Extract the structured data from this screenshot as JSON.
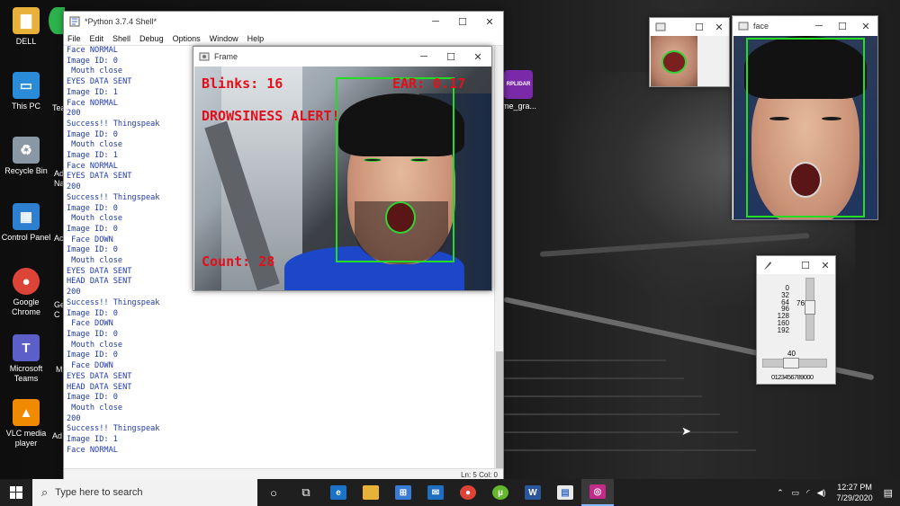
{
  "desktop": {
    "icons": [
      {
        "label": "DELL",
        "icon": "folder-user-icon",
        "color": "#e8b23a"
      },
      {
        "label": "This PC",
        "icon": "monitor-icon",
        "color": "#2a8cd8"
      },
      {
        "label": "Recycle Bin",
        "icon": "recycle-bin-icon",
        "color": "#8a98a6"
      },
      {
        "label": "Control Panel",
        "icon": "control-panel-icon",
        "color": "#2d7fd0"
      },
      {
        "label": "Google Chrome",
        "icon": "chrome-icon",
        "color": "#db4437"
      },
      {
        "label": "Microsoft Teams",
        "icon": "teams-icon",
        "color": "#5b5fc7"
      },
      {
        "label": "VLC media player",
        "icon": "vlc-icon",
        "color": "#f08a00"
      }
    ],
    "partial_labels": [
      "Tea",
      "Ad Na",
      "Ac",
      "Ge C",
      "M",
      "Ad"
    ],
    "file_icon": {
      "label": "ime_gra...",
      "glyph": "RPLIDAR",
      "color": "#7a2aa8"
    }
  },
  "shell": {
    "title": "*Python 3.7.4 Shell*",
    "menu": [
      "File",
      "Edit",
      "Shell",
      "Debug",
      "Options",
      "Window",
      "Help"
    ],
    "lines": [
      "Face NORMAL",
      "Image ID: 0",
      " Mouth close",
      "EYES DATA SENT",
      "Image ID: 1",
      "Face NORMAL",
      "200",
      "Success!! Thingspeak",
      "Image ID: 0",
      " Mouth close",
      "Image ID: 1",
      "Face NORMAL",
      "EYES DATA SENT",
      "200",
      "Success!! Thingspeak",
      "Image ID: 0",
      " Mouth close",
      "Image ID: 0",
      " Face DOWN",
      "Image ID: 0",
      " Mouth close",
      "EYES DATA SENT",
      "HEAD DATA SENT",
      "200",
      "Success!! Thingspeak",
      "Image ID: 0",
      " Face DOWN",
      "Image ID: 0",
      " Mouth close",
      "Image ID: 0",
      " Face DOWN",
      "EYES DATA SENT",
      "HEAD DATA SENT",
      "Image ID: 0",
      " Mouth close",
      "200",
      "Success!! Thingspeak",
      "Image ID: 1",
      "Face NORMAL"
    ],
    "status": "Ln: 5   Col: 0"
  },
  "frame": {
    "title": "Frame",
    "blinks": "Blinks: 16",
    "ear": "EAR: 0.17",
    "alert": "DROWSINESS ALERT!",
    "count": "Count: 28",
    "overlay_color": "#e2101a",
    "box_color": "#22dd22"
  },
  "face_window": {
    "title": "face"
  },
  "small_window": {
    "title": ""
  },
  "slider": {
    "title": "",
    "v_labels": [
      "0",
      "32",
      "64",
      "96",
      "128",
      "160",
      "192"
    ],
    "v_value": "76",
    "h_value": "40",
    "h_labels": "0123456789000"
  },
  "taskbar": {
    "search_placeholder": "Type here to search",
    "time": "12:27 PM",
    "date": "7/29/2020"
  }
}
